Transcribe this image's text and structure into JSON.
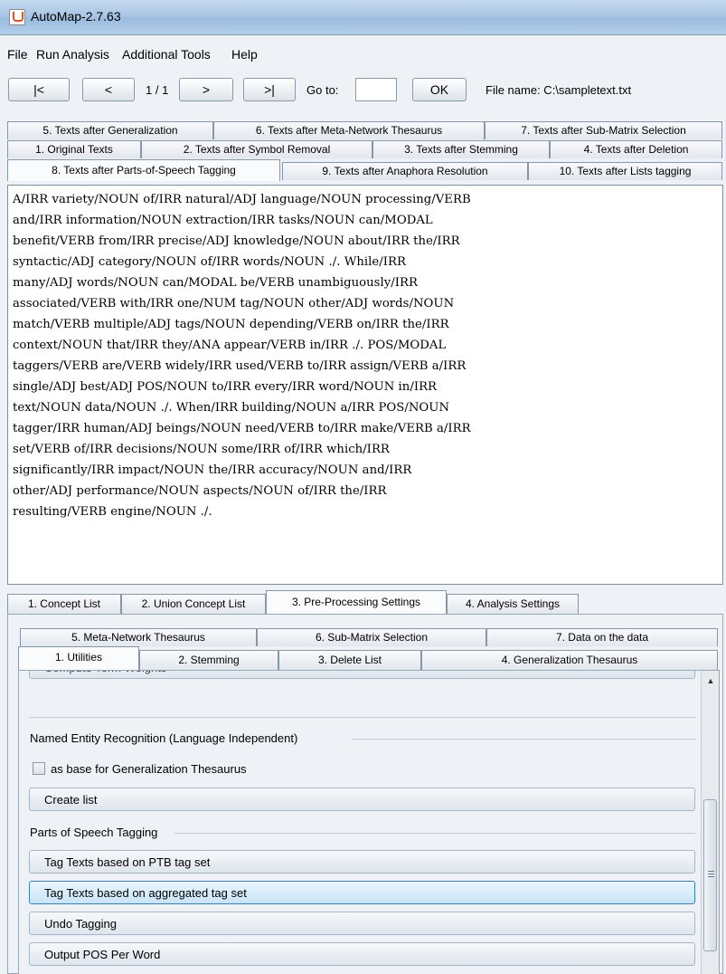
{
  "window": {
    "title": "AutoMap-2.7.63"
  },
  "menu": [
    "File",
    "Run Analysis",
    "Additional Tools",
    "Help"
  ],
  "nav": {
    "first": "|<",
    "prev": "<",
    "page": "1 / 1",
    "next": ">",
    "last": ">|",
    "goto_label": "Go to:",
    "goto_value": "",
    "ok": "OK",
    "file_name": "File name: C:\\sampletext.txt"
  },
  "text_tabs": {
    "row1": [
      "5. Texts after Generalization",
      "6. Texts after Meta-Network Thesaurus",
      "7. Texts after Sub-Matrix Selection"
    ],
    "row2": [
      "1. Original Texts",
      "2. Texts after Symbol Removal",
      "3. Texts after Stemming",
      "4. Texts after Deletion"
    ],
    "row3": [
      "8. Texts after Parts-of-Speech Tagging",
      "9. Texts after Anaphora Resolution",
      "10. Texts after Lists tagging"
    ]
  },
  "text_content": "A/IRR variety/NOUN of/IRR natural/ADJ language/NOUN processing/VERB\nand/IRR information/NOUN extraction/IRR tasks/NOUN can/MODAL\nbenefit/VERB from/IRR precise/ADJ knowledge/NOUN about/IRR the/IRR\nsyntactic/ADJ category/NOUN of/IRR words/NOUN  ./. While/IRR\nmany/ADJ words/NOUN can/MODAL be/VERB unambiguously/IRR\nassociated/VERB with/IRR one/NUM tag/NOUN other/ADJ words/NOUN\nmatch/VERB multiple/ADJ tags/NOUN depending/VERB on/IRR the/IRR\ncontext/NOUN that/IRR they/ANA appear/VERB in/IRR  ./. POS/MODAL\ntaggers/VERB are/VERB widely/IRR used/VERB to/IRR assign/VERB a/IRR\nsingle/ADJ best/ADJ POS/NOUN to/IRR every/IRR word/NOUN in/IRR\ntext/NOUN data/NOUN  ./. When/IRR building/NOUN a/IRR POS/NOUN\ntagger/IRR human/ADJ beings/NOUN need/VERB to/IRR make/VERB a/IRR\nset/VERB of/IRR decisions/NOUN some/IRR of/IRR which/IRR\nsignificantly/IRR impact/NOUN the/IRR accuracy/NOUN and/IRR\nother/ADJ performance/NOUN aspects/NOUN of/IRR the/IRR\nresulting/VERB engine/NOUN  ./.",
  "main_tabs": [
    "1. Concept List",
    "2. Union Concept List",
    "3. Pre-Processing Settings",
    "4. Analysis Settings"
  ],
  "sub_tabs": {
    "row1": [
      "5. Meta-Network Thesaurus",
      "6. Sub-Matrix Selection",
      "7. Data on the data"
    ],
    "row2": [
      "1. Utilities",
      "2. Stemming",
      "3. Delete List",
      "4. Generalization Thesaurus"
    ]
  },
  "utilities": {
    "partial_button": "Compute Term Weights",
    "ner_group": "Named Entity Recognition (Language Independent)",
    "ner_checkbox": "as base for Generalization Thesaurus",
    "create_list": "Create list",
    "pos_group": "Parts of Speech Tagging",
    "tag_ptb": "Tag Texts based on PTB tag set",
    "tag_aggregated": "Tag Texts based on aggregated tag set",
    "undo_tagging": "Undo Tagging",
    "output_pos": "Output POS Per Word"
  }
}
